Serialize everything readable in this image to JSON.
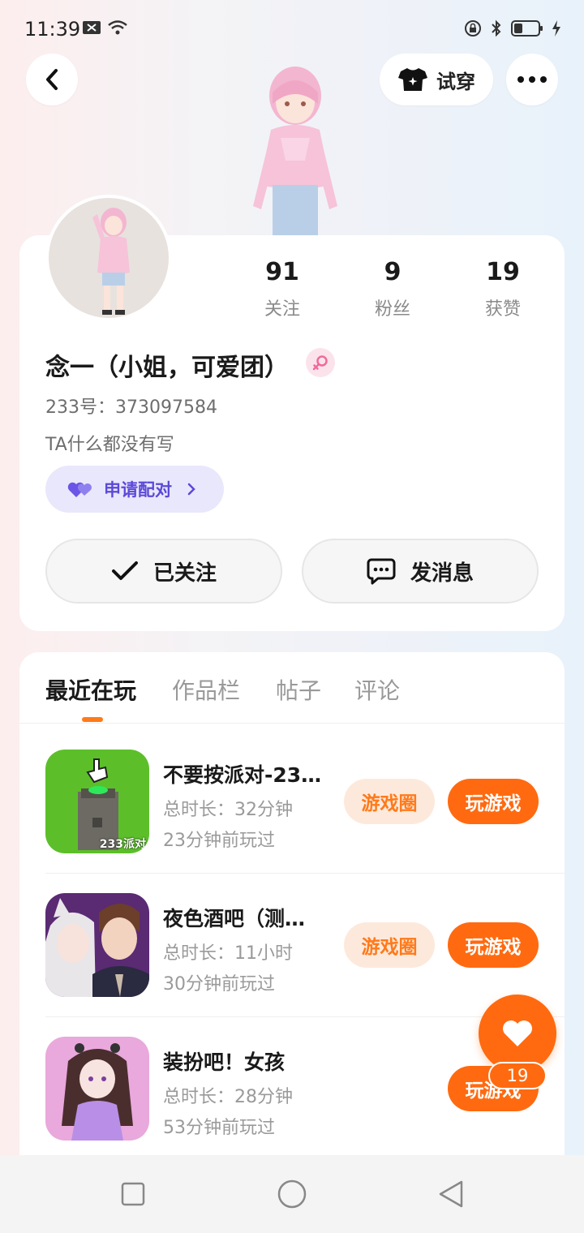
{
  "status_bar": {
    "time": "11:39",
    "icons": [
      "sim-blocked-icon",
      "wifi-icon",
      "lock-rotation-icon",
      "bluetooth-icon",
      "battery-icon",
      "charging-icon"
    ]
  },
  "header": {
    "back_icon": "chevron-left-icon",
    "try_on_label": "试穿",
    "more_icon": "more-dots-icon"
  },
  "profile": {
    "stats": [
      {
        "value": "91",
        "label": "关注"
      },
      {
        "value": "9",
        "label": "粉丝"
      },
      {
        "value": "19",
        "label": "获赞"
      }
    ],
    "nickname": "念一（小姐，可爱团）",
    "gender": "female",
    "user_id": "233号：373097584",
    "bio": "TA什么都没有写",
    "pair_label": "申请配对",
    "followed_label": "已关注",
    "message_label": "发消息"
  },
  "tabs": [
    "最近在玩",
    "作品栏",
    "帖子",
    "评论"
  ],
  "active_tab": 0,
  "games": [
    {
      "title": "不要按派对-23…",
      "duration": "总时长：32分钟",
      "last_played": "23分钟前玩过",
      "circle_label": "游戏圈",
      "play_label": "玩游戏"
    },
    {
      "title": "夜色酒吧（测…",
      "duration": "总时长：11小时",
      "last_played": "30分钟前玩过",
      "circle_label": "游戏圈",
      "play_label": "玩游戏"
    },
    {
      "title": "装扮吧！女孩",
      "duration": "总时长：28分钟",
      "last_played": "53分钟前玩过",
      "circle_label": "",
      "play_label": "玩游戏"
    }
  ],
  "game_icon_text": "233派对",
  "like_count": "19",
  "colors": {
    "accent": "#ff6a10",
    "accent_light": "#fde9dc",
    "pair_bg": "#e9e7fb",
    "pair_text": "#5b49d8"
  }
}
